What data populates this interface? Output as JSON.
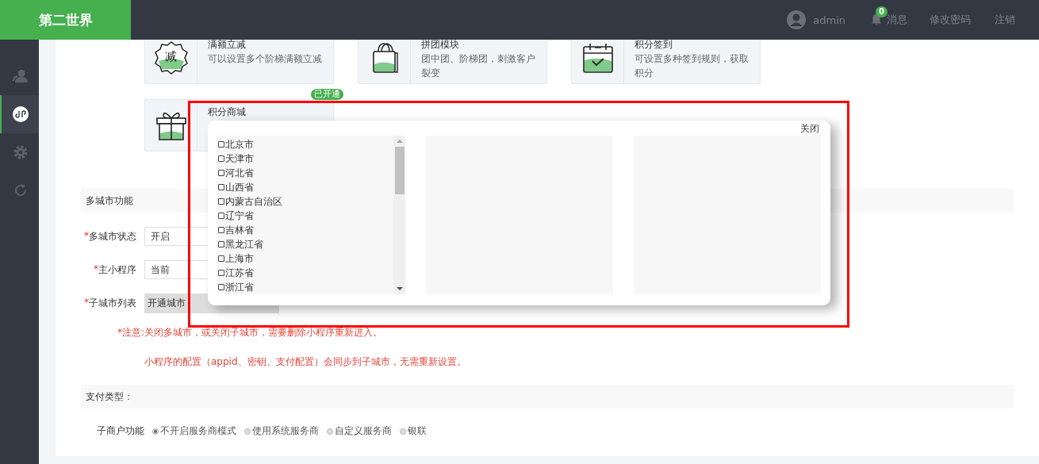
{
  "header": {
    "logo": "第二世界",
    "user": "admin",
    "notifications": {
      "count": "0",
      "label": "消息"
    },
    "links": [
      "修改密码",
      "注销"
    ]
  },
  "sidebar": {
    "items": [
      {
        "kind": "user",
        "selected": false
      },
      {
        "kind": "link",
        "selected": true
      },
      {
        "kind": "gear",
        "selected": false
      },
      {
        "kind": "refresh",
        "selected": false
      }
    ]
  },
  "features": [
    {
      "kind": "reduce",
      "icon_text": "减",
      "title": "满额立减",
      "description": "可以设置多个阶梯满额立减"
    },
    {
      "kind": "bag",
      "title": "拼团模块",
      "description": "团中团、阶梯团，刺激客户裂变"
    },
    {
      "kind": "calendar",
      "title": "积分签到",
      "description": "可设置多种签到规则，获取积分"
    },
    {
      "kind": "gift",
      "title": "积分商城",
      "badge": "已开通"
    }
  ],
  "multi_city": {
    "section_title": "多城市功能",
    "fields": [
      {
        "label": "多城市状态",
        "required_mark": "*",
        "kind": "select",
        "value": "开启"
      },
      {
        "label": "主小程序",
        "required_mark": "*",
        "kind": "select",
        "value": "当前"
      },
      {
        "label": "子城市列表",
        "required_mark": "*",
        "kind": "button",
        "value": "开通城市"
      }
    ],
    "note": {
      "label": "*注意:",
      "lines": [
        "关闭多城市，或关闭子城市，需要删除小程序重新进入。",
        "小程序的配置（appid、密钥、支付配置）会同步到子城市，无需重新设置。"
      ]
    }
  },
  "payment": {
    "section_title": "支付类型：",
    "label": "子商户功能",
    "options": [
      {
        "label": "不开启服务商模式",
        "selected": true
      },
      {
        "label": "使用系统服务商",
        "selected": false
      },
      {
        "label": "自定义服务商",
        "selected": false
      },
      {
        "label": "银联",
        "selected": false
      }
    ]
  },
  "modal": {
    "close": "关闭",
    "provinces": [
      {
        "name": "北京市",
        "checked": false
      },
      {
        "name": "天津市",
        "checked": false
      },
      {
        "name": "河北省",
        "checked": false
      },
      {
        "name": "山西省",
        "checked": false
      },
      {
        "name": "内蒙古自治区",
        "checked": false
      },
      {
        "name": "辽宁省",
        "checked": false
      },
      {
        "name": "吉林省",
        "checked": false
      },
      {
        "name": "黑龙江省",
        "checked": false
      },
      {
        "name": "上海市",
        "checked": false
      },
      {
        "name": "江苏省",
        "checked": false
      },
      {
        "name": "浙江省",
        "checked": false
      }
    ]
  }
}
